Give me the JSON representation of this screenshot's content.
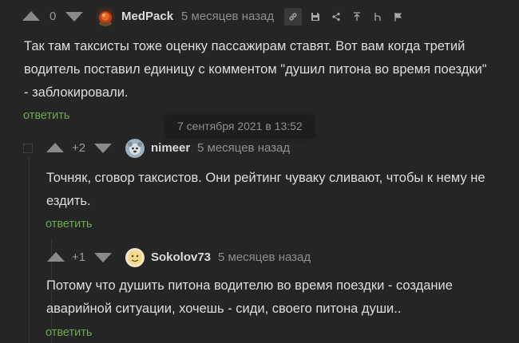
{
  "comments": [
    {
      "score": "0",
      "username": "MedPack",
      "time": "5 месяцев назад",
      "lines": [
        "Так там таксисты тоже оценку пассажирам ставят. Вот вам когда третий",
        "водитель поставил единицу с комментом \"душил питона во время поездки\"",
        "- заблокировали."
      ],
      "reply": "ответить",
      "toolbar": [
        "link-icon",
        "save-icon",
        "share-icon",
        "upload-icon",
        "branch-icon",
        "flag-icon"
      ]
    },
    {
      "score": "+2",
      "username": "nimeer",
      "time": "5 месяцев назад",
      "lines": [
        "Точняк, сговор таксистов. Они рейтинг чуваку сливают, чтобы к нему не",
        "ездить."
      ],
      "reply": "ответить"
    },
    {
      "score": "+1",
      "username": "Sokolov73",
      "time": "5 месяцев назад",
      "lines": [
        "Потому что душить питона водителю во время поездки - создание",
        "аварийной ситуации, хочешь - сиди, своего питона души.."
      ],
      "reply": "ответить"
    }
  ],
  "tooltip": "7 сентября 2021 в 13:52",
  "colors": {
    "background": "#252525",
    "reply_link": "#6aaa4b",
    "vote_arrow": "#8a8a8a",
    "toolbar_active_bg": "#3a3a3a"
  }
}
